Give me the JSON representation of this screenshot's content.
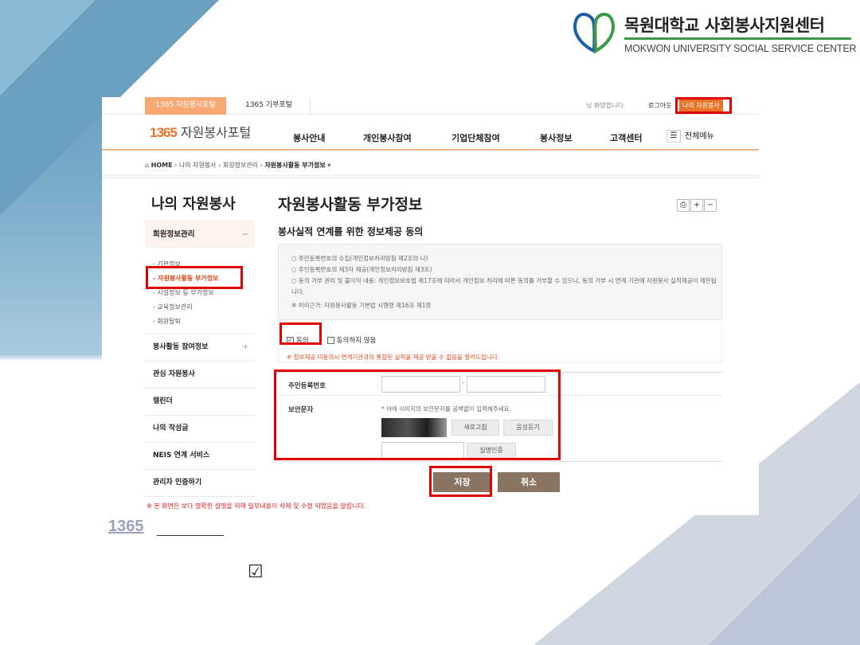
{
  "university": {
    "name_ko": "목원대학교 사회봉사지원센터",
    "name_en": "MOKWON UNIVERSITY SOCIAL SERVICE CENTER"
  },
  "portal": {
    "top_tabs": [
      "1365 자원봉사포털",
      "1365 기부포털"
    ],
    "welcome": "님 환영합니다.",
    "login": "로그아웃",
    "my_volunteer": "나의 자원봉사",
    "logo_num": "1365",
    "logo_text": "자원봉사포털",
    "menus": [
      "봉사안내",
      "개인봉사참여",
      "기업단체참여",
      "봉사정보",
      "고객센터"
    ],
    "all_menu": "전체메뉴",
    "breadcrumb": {
      "home": "HOME",
      "items": [
        "나의 자원봉사",
        "회원정보관리",
        "자원봉사활동 부가정보"
      ]
    }
  },
  "sidebar": {
    "title": "나의 자원봉사",
    "section": "회원정보관리",
    "section_sign": "−",
    "sub_items": [
      "- 기본정보",
      "- 자원봉사활동 부가정보",
      "- 시설정보 등 부가정보",
      "- 교육정보관리",
      "- 회원탈퇴"
    ],
    "items": [
      {
        "label": "봉사활동 참여정보",
        "sign": "+"
      },
      {
        "label": "관심 자원봉사",
        "sign": ""
      },
      {
        "label": "캘린더",
        "sign": ""
      },
      {
        "label": "나의 작성글",
        "sign": ""
      },
      {
        "label": "NEIS 연계 서비스",
        "sign": ""
      },
      {
        "label": "관리자 인증하기",
        "sign": ""
      }
    ]
  },
  "main": {
    "page_title": "자원봉사활동 부가정보",
    "tool_icons": [
      "print-icon",
      "zoom-in-icon",
      "zoom-out-icon"
    ],
    "section_title": "봉사실적 연계를 위한 정보제공 동의",
    "info_lines": [
      "○ 주민등록번호의 수집(개인정보처리방침 제2조의 나)",
      "○ 주민등록번호의 제3자 제공(개인정보처리방침 제3조)",
      "○ 동의 거부 권리 및 불이익 내용: 개인정보보호법 제17조에 따라서 개인정보 처리에 따른 동의를 거부할 수 있으나, 동의 거부 시 연계 기관에 자원봉사 실적제공이 제한됩니다.",
      "※ 처리근거: 자원봉사활동 기본법 시행령 제16조 제1항"
    ],
    "agree_label": "동의",
    "disagree_label": "동의하지 않음",
    "agree_checked": true,
    "warning": "※ 정보제공 미동의시 연계기관과의 통합된 실적을 제공 받을 수 없음을 알려드립니다.",
    "form": {
      "rrn_label": "주민등록번호",
      "rrn_separator": "-",
      "captcha_label": "보안문자",
      "captcha_hint": "* 아래 이미지의 보안문자를 공백없이 입력해주세요.",
      "refresh_btn": "새로고침",
      "audio_btn": "음성듣기",
      "verify_btn": "실명인증"
    },
    "save_btn": "저장",
    "cancel_btn": "취소",
    "notice": "※ 본 화면은 보다 명확한 설명을 위해 일부내용이 삭제 및 수정 되었음을 알립니다."
  },
  "slide": {
    "label_1365": "1365",
    "checkbox_glyph": "☑"
  },
  "colors": {
    "accent": "#e8732a",
    "highlight_red": "#e30000",
    "button_brown": "#8a7563",
    "logo_green": "#3a9a4a",
    "logo_blue": "#1e5fa8"
  }
}
